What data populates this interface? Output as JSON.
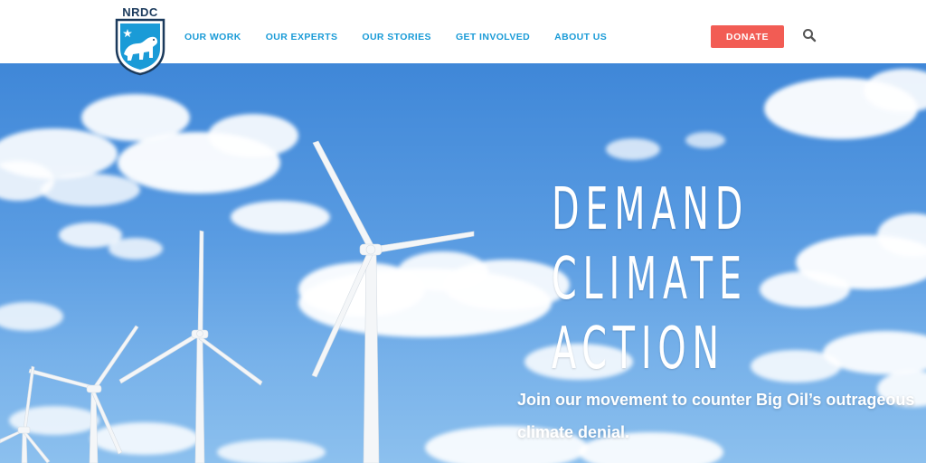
{
  "logo": {
    "text": "NRDC",
    "icon": "polar-bear-shield-icon"
  },
  "nav": {
    "items": [
      {
        "label": "OUR WORK"
      },
      {
        "label": "OUR EXPERTS"
      },
      {
        "label": "OUR STORIES"
      },
      {
        "label": "GET INVOLVED"
      },
      {
        "label": "ABOUT US"
      }
    ],
    "donate_label": "DONATE",
    "search_icon": "search-icon"
  },
  "hero": {
    "headline_lines": [
      "DEMAND",
      "CLIMATE",
      "ACTION"
    ],
    "subtext": "Join our movement to counter Big Oil’s outrageous climate denial."
  },
  "colors": {
    "nav_text": "#1a9bd7",
    "donate_bg": "#f25c54",
    "logo_navy": "#1b3a5c",
    "sky_top": "#3f87d8",
    "sky_bottom": "#8cc0ee"
  }
}
